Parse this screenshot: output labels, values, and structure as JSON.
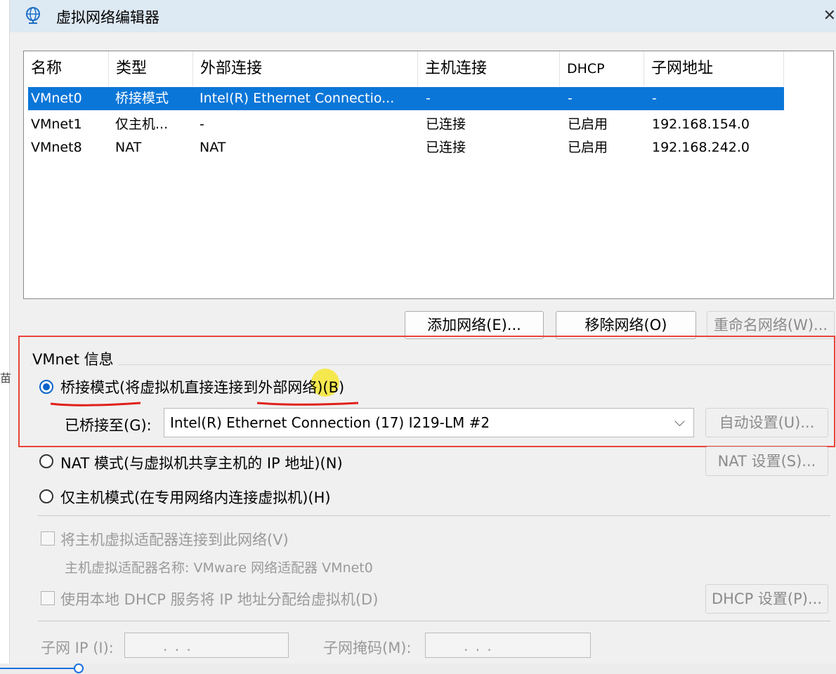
{
  "window": {
    "title": "虚拟网络编辑器",
    "left_strip_char": "苗"
  },
  "table": {
    "columns": [
      "名称",
      "类型",
      "外部连接",
      "主机连接",
      "DHCP",
      "子网地址"
    ],
    "rows": [
      {
        "name": "VMnet0",
        "type": "桥接模式",
        "external": "Intel(R) Ethernet Connectio...",
        "host": "-",
        "dhcp": "-",
        "subnet": "-",
        "selected": true
      },
      {
        "name": "VMnet1",
        "type": "仅主机...",
        "external": "-",
        "host": "已连接",
        "dhcp": "已启用",
        "subnet": "192.168.154.0",
        "selected": false
      },
      {
        "name": "VMnet8",
        "type": "NAT",
        "external": "NAT",
        "host": "已连接",
        "dhcp": "已启用",
        "subnet": "192.168.242.0",
        "selected": false
      }
    ]
  },
  "buttons": {
    "add_network": "添加网络(E)...",
    "remove_network": "移除网络(O)",
    "rename_network": "重命名网络(W)..."
  },
  "vmnet_info": {
    "group_label": "VMnet 信息",
    "bridged_option": "桥接模式(将虚拟机直接连接到外部网络)(B)",
    "bridged_to_label": "已桥接至(G):",
    "bridged_to_value": "Intel(R) Ethernet Connection (17) I219-LM #2",
    "auto_settings": "自动设置(U)...",
    "nat_option": "NAT 模式(与虚拟机共享主机的 IP 地址)(N)",
    "nat_settings": "NAT 设置(S)...",
    "hostonly_option": "仅主机模式(在专用网络内连接虚拟机)(H)",
    "connect_adapter": "将主机虚拟适配器连接到此网络(V)",
    "adapter_name": "主机虚拟适配器名称: VMware 网络适配器 VMnet0",
    "use_dhcp": "使用本地 DHCP 服务将 IP 地址分配给虚拟机(D)",
    "dhcp_settings": "DHCP 设置(P)...",
    "subnet_ip_label": "子网 IP (I):",
    "subnet_mask_label": "子网掩码(M):",
    "ip_placeholder": ".     .     .",
    "selected_mode": "bridged"
  },
  "colors": {
    "selection": "#0a76d8",
    "highlight_box": "#e8443b",
    "annotation_underline": "#e0201b",
    "cursor_highlight": "#f7e51a"
  }
}
